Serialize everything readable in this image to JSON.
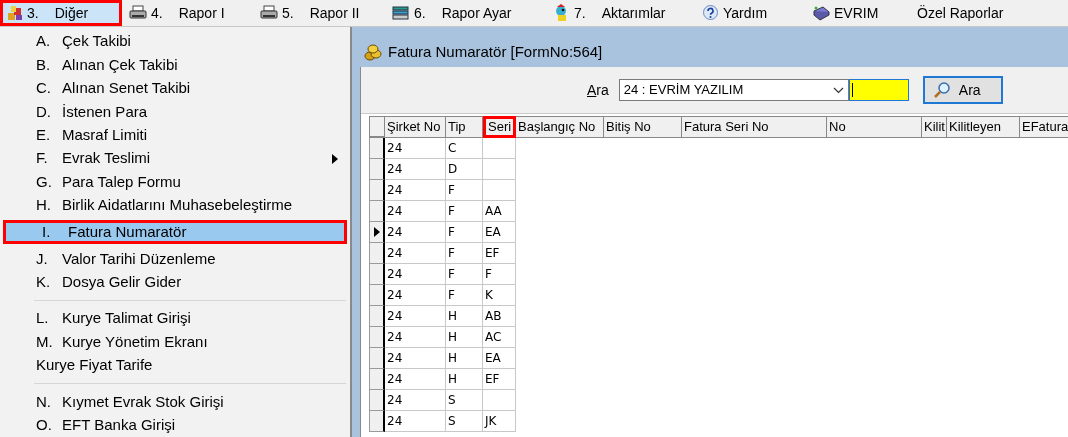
{
  "menubar": [
    {
      "number": "3.",
      "label": "Diğer",
      "selected": true
    },
    {
      "number": "4.",
      "label": "Rapor I",
      "selected": false
    },
    {
      "number": "5.",
      "label": "Rapor II",
      "selected": false
    },
    {
      "number": "6.",
      "label": "Rapor Ayar",
      "selected": false
    },
    {
      "number": "7.",
      "label": "Aktarımlar",
      "selected": false
    },
    {
      "label": "Yardım",
      "selected": false
    },
    {
      "label": "EVRIM",
      "selected": false
    },
    {
      "label": "Özel Raporlar",
      "selected": false
    }
  ],
  "dropdown": [
    {
      "kind": "item",
      "letter": "A.",
      "label": "Çek Takibi",
      "selected": false
    },
    {
      "kind": "item",
      "letter": "B.",
      "label": "Alınan Çek Takibi",
      "selected": false
    },
    {
      "kind": "item",
      "letter": "C.",
      "label": "Alınan Senet Takibi",
      "selected": false
    },
    {
      "kind": "item",
      "letter": "D.",
      "label": "İstenen Para",
      "selected": false
    },
    {
      "kind": "item",
      "letter": "E.",
      "label": "Masraf Limiti",
      "selected": false
    },
    {
      "kind": "item",
      "letter": "F.",
      "label": "Evrak Teslimi",
      "selected": false,
      "submenu": true
    },
    {
      "kind": "item",
      "letter": "G.",
      "label": "Para Talep Formu",
      "selected": false
    },
    {
      "kind": "item",
      "letter": "H.",
      "label": "Birlik Aidatlarını Muhasebeleştirme",
      "selected": false
    },
    {
      "kind": "item",
      "letter": "I.",
      "label": "Fatura Numaratör",
      "selected": true
    },
    {
      "kind": "item",
      "letter": "J.",
      "label": "Valor Tarihi Düzenleme",
      "selected": false
    },
    {
      "kind": "item",
      "letter": "K.",
      "label": "Dosya Gelir Gider",
      "selected": false
    },
    {
      "kind": "separator"
    },
    {
      "kind": "item",
      "letter": "L.",
      "label": "Kurye Talimat Girişi",
      "selected": false
    },
    {
      "kind": "item",
      "letter": "M.",
      "label": "Kurye Yönetim Ekranı",
      "selected": false
    },
    {
      "kind": "item",
      "label": "Kurye Fiyat Tarife",
      "selected": false
    },
    {
      "kind": "separator"
    },
    {
      "kind": "item",
      "letter": "N.",
      "label": "Kıymet Evrak Stok Girişi",
      "selected": false
    },
    {
      "kind": "item",
      "letter": "O.",
      "label": "EFT Banka Girişi",
      "selected": false
    }
  ],
  "window": {
    "title": "Fatura Numaratör [FormNo:564]"
  },
  "toolbar": {
    "search_label": "Ara",
    "company_select": "24 : EVRİM YAZILIM",
    "search_button": "Ara"
  },
  "table": {
    "columns": [
      {
        "label": "Şirket No",
        "highlighted": false
      },
      {
        "label": "Tip",
        "highlighted": false
      },
      {
        "label": "Seri",
        "highlighted": true
      },
      {
        "label": "Başlangıç No",
        "highlighted": false
      },
      {
        "label": "Bitiş No",
        "highlighted": false
      },
      {
        "label": "Fatura Seri No",
        "highlighted": false
      },
      {
        "label": "No",
        "highlighted": false
      },
      {
        "label": "Kilit",
        "highlighted": false
      },
      {
        "label": "Kilitleyen",
        "highlighted": false
      },
      {
        "label": "EFatura",
        "highlighted": false
      }
    ],
    "rows": [
      {
        "cells": [
          "24",
          "C",
          ""
        ],
        "selected": false
      },
      {
        "cells": [
          "24",
          "D",
          ""
        ],
        "selected": false
      },
      {
        "cells": [
          "24",
          "F",
          ""
        ],
        "selected": false
      },
      {
        "cells": [
          "24",
          "F",
          "AA"
        ],
        "selected": false
      },
      {
        "cells": [
          "24",
          "F",
          "EA"
        ],
        "selected": true
      },
      {
        "cells": [
          "24",
          "F",
          "EF"
        ],
        "selected": false
      },
      {
        "cells": [
          "24",
          "F",
          "F"
        ],
        "selected": false
      },
      {
        "cells": [
          "24",
          "F",
          "K"
        ],
        "selected": false
      },
      {
        "cells": [
          "24",
          "H",
          "AB"
        ],
        "selected": false
      },
      {
        "cells": [
          "24",
          "H",
          "AC"
        ],
        "selected": false
      },
      {
        "cells": [
          "24",
          "H",
          "EA"
        ],
        "selected": false
      },
      {
        "cells": [
          "24",
          "H",
          "EF"
        ],
        "selected": false
      },
      {
        "cells": [
          "24",
          "S",
          ""
        ],
        "selected": false
      },
      {
        "cells": [
          "24",
          "S",
          "JK"
        ],
        "selected": false
      }
    ]
  }
}
